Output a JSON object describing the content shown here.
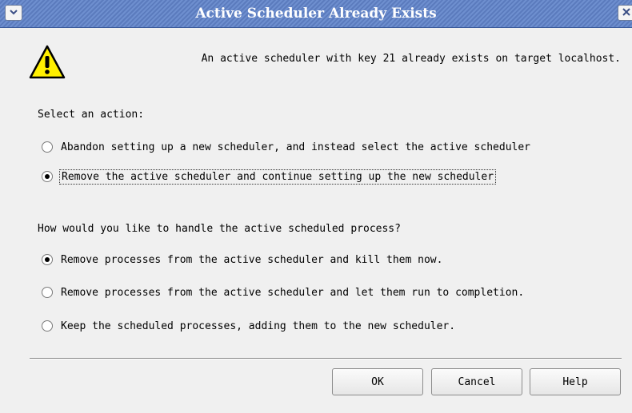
{
  "window": {
    "title": "Active Scheduler Already Exists",
    "menu_icon": "chevron-down-icon",
    "close_icon": "close-icon"
  },
  "message": {
    "icon": "warning-icon",
    "text": "An active scheduler with key 21 already exists on target localhost."
  },
  "action_section": {
    "label": "Select an action:",
    "options": [
      {
        "label": "Abandon setting up a new scheduler, and instead select the active scheduler",
        "checked": false
      },
      {
        "label": "Remove the active scheduler and continue setting up the new scheduler",
        "checked": true,
        "focused": true
      }
    ]
  },
  "process_section": {
    "label": "How would you like to handle the active scheduled process?",
    "options": [
      {
        "label": "Remove processes from the active scheduler and kill them now.",
        "checked": true
      },
      {
        "label": "Remove processes from the active scheduler and let them run to completion.",
        "checked": false
      },
      {
        "label": "Keep the scheduled processes, adding them to the new scheduler.",
        "checked": false
      }
    ]
  },
  "buttons": {
    "ok": "OK",
    "cancel": "Cancel",
    "help": "Help"
  },
  "colors": {
    "titlebar": "#6e8fcf",
    "warning_fill": "#ffef00"
  }
}
